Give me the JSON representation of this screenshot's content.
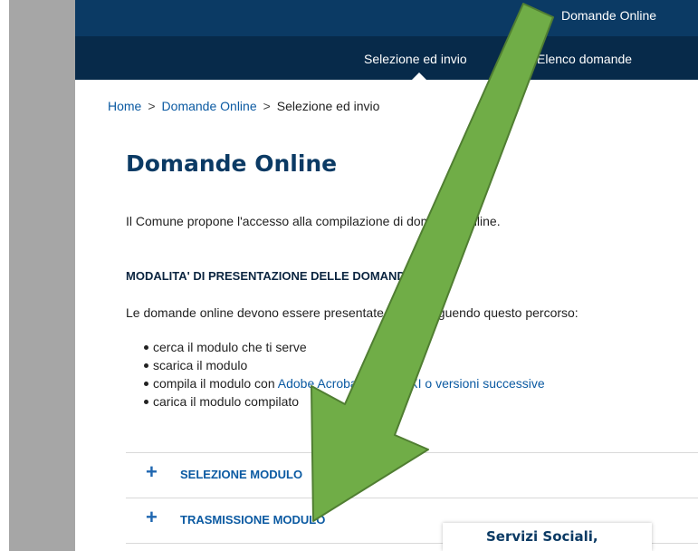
{
  "header": {
    "title": "Domande Online",
    "nav_tabs": [
      {
        "label": "Selezione ed invio"
      },
      {
        "label": "Elenco domande"
      }
    ]
  },
  "breadcrumb": {
    "home": "Home",
    "section": "Domande Online",
    "current": "Selezione ed invio",
    "separator": ">"
  },
  "main": {
    "title": "Domande Online",
    "intro": "Il Comune propone l'accesso alla compilazione di domande online.",
    "subheading": "MODALITA' DI PRESENTAZIONE DELLE DOMANDE",
    "paragraph": "Le domande online devono essere presentate online seguendo questo percorso:",
    "steps": [
      {
        "text": "cerca il modulo che ti serve"
      },
      {
        "text": "scarica il modulo"
      },
      {
        "prefix": "compila il modulo con ",
        "link": "Adobe Acrobat Reader XI o versioni successive"
      },
      {
        "text": "carica il modulo compilato"
      }
    ],
    "accordion": [
      {
        "label": "SELEZIONE MODULO",
        "icon": "plus-icon"
      },
      {
        "label": "TRASMISSIONE MODULO",
        "icon": "plus-icon"
      }
    ]
  },
  "popup": {
    "text": "Servizi Sociali,"
  },
  "annotation": {
    "color": "#70ad47",
    "outline": "#507e32"
  }
}
